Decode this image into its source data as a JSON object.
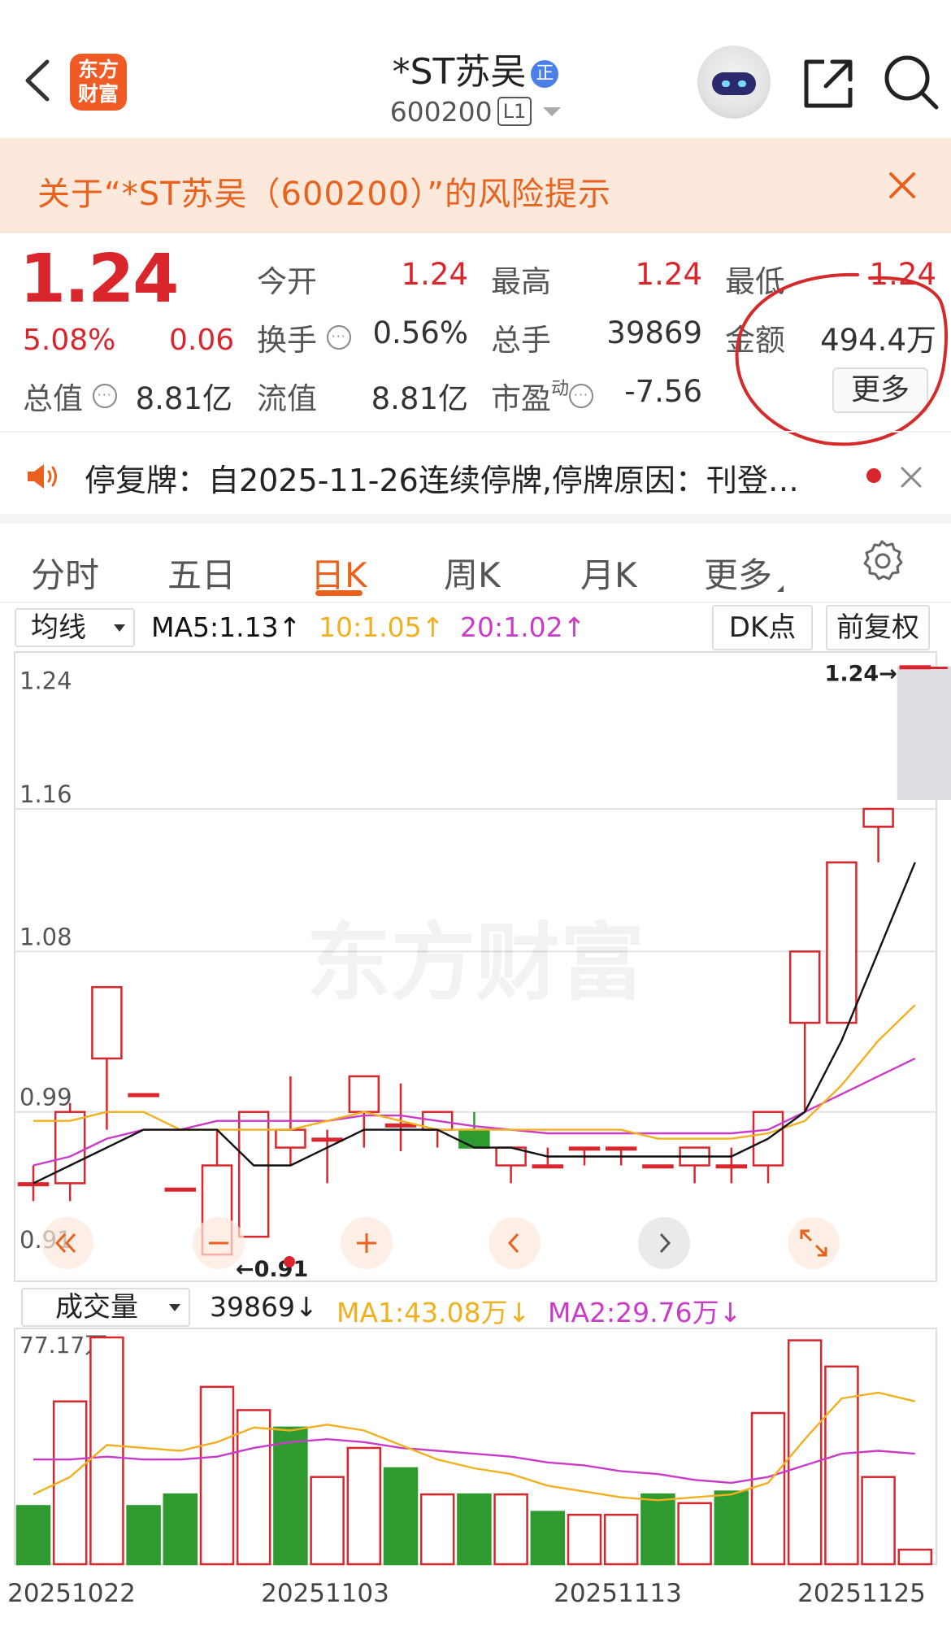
{
  "header": {
    "logo_text_line1": "东方",
    "logo_text_line2": "财富",
    "stock_name": "*ST苏吴",
    "badge": "正",
    "stock_code": "600200",
    "level": "L1"
  },
  "risk_banner": {
    "text": "关于“*ST苏吴（600200）”的风险提示"
  },
  "quote": {
    "price": "1.24",
    "change_pct": "5.08%",
    "change": "0.06",
    "open_label": "今开",
    "open": "1.24",
    "high_label": "最高",
    "high": "1.24",
    "low_label": "最低",
    "low": "1.24",
    "turnover_label": "换手",
    "turnover": "0.56%",
    "volume_label": "总手",
    "volume": "39869",
    "amount_label": "金额",
    "amount": "494.4万",
    "mktcap_label": "总值",
    "mktcap": "8.81亿",
    "float_label": "流值",
    "float": "8.81亿",
    "pe_label": "市盈",
    "pe_sup": "动",
    "pe": "-7.56",
    "more_button": "更多"
  },
  "notice": {
    "text": "停复牌：自2025-11-26连续停牌,停牌原因：刊登…"
  },
  "tabs": [
    {
      "label": "分时"
    },
    {
      "label": "五日"
    },
    {
      "label": "日K"
    },
    {
      "label": "周K"
    },
    {
      "label": "月K"
    },
    {
      "label": "更多"
    }
  ],
  "ma_bar": {
    "selector": "均线",
    "ma5": "MA5:1.13↑",
    "ma10": "10:1.05↑",
    "ma20": "20:1.02↑",
    "dk_button": "DK点",
    "adjust_button": "前复权"
  },
  "volume_bar": {
    "selector": "成交量",
    "vol": "39869↓",
    "ma1": "MA1:43.08万↓",
    "ma2": "MA2:29.76万↓"
  },
  "colors": {
    "up": "#d9262c",
    "down": "#2f9a2f",
    "accent": "#e8621e",
    "ma5": "#111111",
    "ma10": "#f0b020",
    "ma20": "#c83cc8"
  },
  "icons": [
    "back-icon",
    "share-icon",
    "search-icon",
    "close-icon",
    "speaker-icon",
    "gear-icon",
    "double-left-icon",
    "minus-icon",
    "plus-icon",
    "left-icon",
    "right-icon",
    "expand-icon"
  ],
  "chart_data": [
    {
      "type": "candlestick",
      "y_ticks": [
        "1.24",
        "1.16",
        "1.08",
        "0.99",
        "0.91"
      ],
      "ylim": [
        0.91,
        1.24
      ],
      "watermark": "东方财富",
      "last_price_label": "1.24→",
      "min_price_label": "←0.91",
      "candles": [
        {
          "o": 0.95,
          "h": 0.96,
          "l": 0.94,
          "c": 0.95
        },
        {
          "o": 0.95,
          "h": 0.995,
          "l": 0.94,
          "c": 0.99
        },
        {
          "o": 1.02,
          "h": 1.06,
          "l": 0.98,
          "c": 1.06
        },
        {
          "o": 1.0,
          "h": 1.0,
          "l": 1.0,
          "c": 1.0
        },
        {
          "o": 0.947,
          "h": 0.947,
          "l": 0.947,
          "c": 0.947
        },
        {
          "o": 0.91,
          "h": 0.98,
          "l": 0.91,
          "c": 0.96
        },
        {
          "o": 0.92,
          "h": 0.99,
          "l": 0.92,
          "c": 0.99
        },
        {
          "o": 0.97,
          "h": 1.01,
          "l": 0.96,
          "c": 0.98
        },
        {
          "o": 0.975,
          "h": 0.98,
          "l": 0.95,
          "c": 0.975
        },
        {
          "o": 0.99,
          "h": 1.004,
          "l": 0.97,
          "c": 1.01
        },
        {
          "o": 0.983,
          "h": 1.006,
          "l": 0.968,
          "c": 0.983
        },
        {
          "o": 0.98,
          "h": 0.99,
          "l": 0.97,
          "c": 0.99
        },
        {
          "o": 0.98,
          "h": 0.99,
          "l": 0.97,
          "c": 0.97
        },
        {
          "o": 0.96,
          "h": 0.97,
          "l": 0.95,
          "c": 0.97
        },
        {
          "o": 0.96,
          "h": 0.97,
          "l": 0.96,
          "c": 0.96
        },
        {
          "o": 0.97,
          "h": 0.97,
          "l": 0.96,
          "c": 0.97
        },
        {
          "o": 0.97,
          "h": 0.97,
          "l": 0.96,
          "c": 0.97
        },
        {
          "o": 0.96,
          "h": 0.96,
          "l": 0.96,
          "c": 0.96
        },
        {
          "o": 0.96,
          "h": 0.97,
          "l": 0.95,
          "c": 0.97
        },
        {
          "o": 0.96,
          "h": 0.97,
          "l": 0.95,
          "c": 0.96
        },
        {
          "o": 0.96,
          "h": 0.99,
          "l": 0.95,
          "c": 0.99
        },
        {
          "o": 1.04,
          "h": 1.08,
          "l": 0.99,
          "c": 1.08
        },
        {
          "o": 1.04,
          "h": 1.13,
          "l": 1.04,
          "c": 1.13
        },
        {
          "o": 1.15,
          "h": 1.16,
          "l": 1.13,
          "c": 1.16
        },
        {
          "o": 1.24,
          "h": 1.24,
          "l": 1.24,
          "c": 1.24
        }
      ],
      "ma5": [
        0.95,
        0.96,
        0.97,
        0.98,
        0.98,
        0.98,
        0.96,
        0.96,
        0.97,
        0.98,
        0.98,
        0.98,
        0.97,
        0.97,
        0.965,
        0.965,
        0.965,
        0.965,
        0.965,
        0.965,
        0.975,
        0.99,
        1.03,
        1.08,
        1.13
      ],
      "ma10": [
        0.985,
        0.985,
        0.99,
        0.99,
        0.98,
        0.98,
        0.98,
        0.98,
        0.985,
        0.99,
        0.985,
        0.98,
        0.98,
        0.98,
        0.98,
        0.98,
        0.98,
        0.975,
        0.975,
        0.975,
        0.978,
        0.985,
        1.005,
        1.03,
        1.05
      ],
      "ma20": [
        0.96,
        0.965,
        0.975,
        0.98,
        0.98,
        0.985,
        0.985,
        0.985,
        0.985,
        0.988,
        0.988,
        0.985,
        0.982,
        0.98,
        0.978,
        0.978,
        0.978,
        0.978,
        0.978,
        0.978,
        0.98,
        0.99,
        1.0,
        1.01,
        1.02
      ]
    },
    {
      "type": "bar",
      "ymax_label": "77.17万",
      "ymax": 77.17,
      "x_ticks": [
        "20251022",
        "20251103",
        "20251113",
        "20251125"
      ],
      "volumes_wan": [
        20,
        56,
        78,
        20,
        24,
        61,
        53,
        47,
        30,
        40,
        33,
        24,
        24,
        24,
        18,
        17,
        17,
        24,
        21,
        25,
        52,
        77,
        68,
        30,
        5
      ],
      "up_down": [
        "down",
        "up",
        "up",
        "down",
        "down",
        "up",
        "up",
        "down",
        "up",
        "up",
        "down",
        "up",
        "down",
        "up",
        "down",
        "up",
        "up",
        "down",
        "up",
        "down",
        "up",
        "up",
        "up",
        "up",
        "up"
      ],
      "ma1": [
        24,
        30,
        41,
        40,
        39,
        42,
        47,
        46,
        48,
        46,
        41,
        36,
        33,
        31,
        27,
        25,
        23,
        22,
        23,
        24,
        28,
        43,
        57,
        59,
        56
      ],
      "ma2": [
        36,
        36,
        37,
        36,
        36,
        37,
        40,
        42,
        43,
        42,
        40,
        39,
        38,
        37,
        35,
        34,
        32,
        31,
        29,
        28,
        30,
        34,
        38,
        39,
        38
      ]
    }
  ]
}
